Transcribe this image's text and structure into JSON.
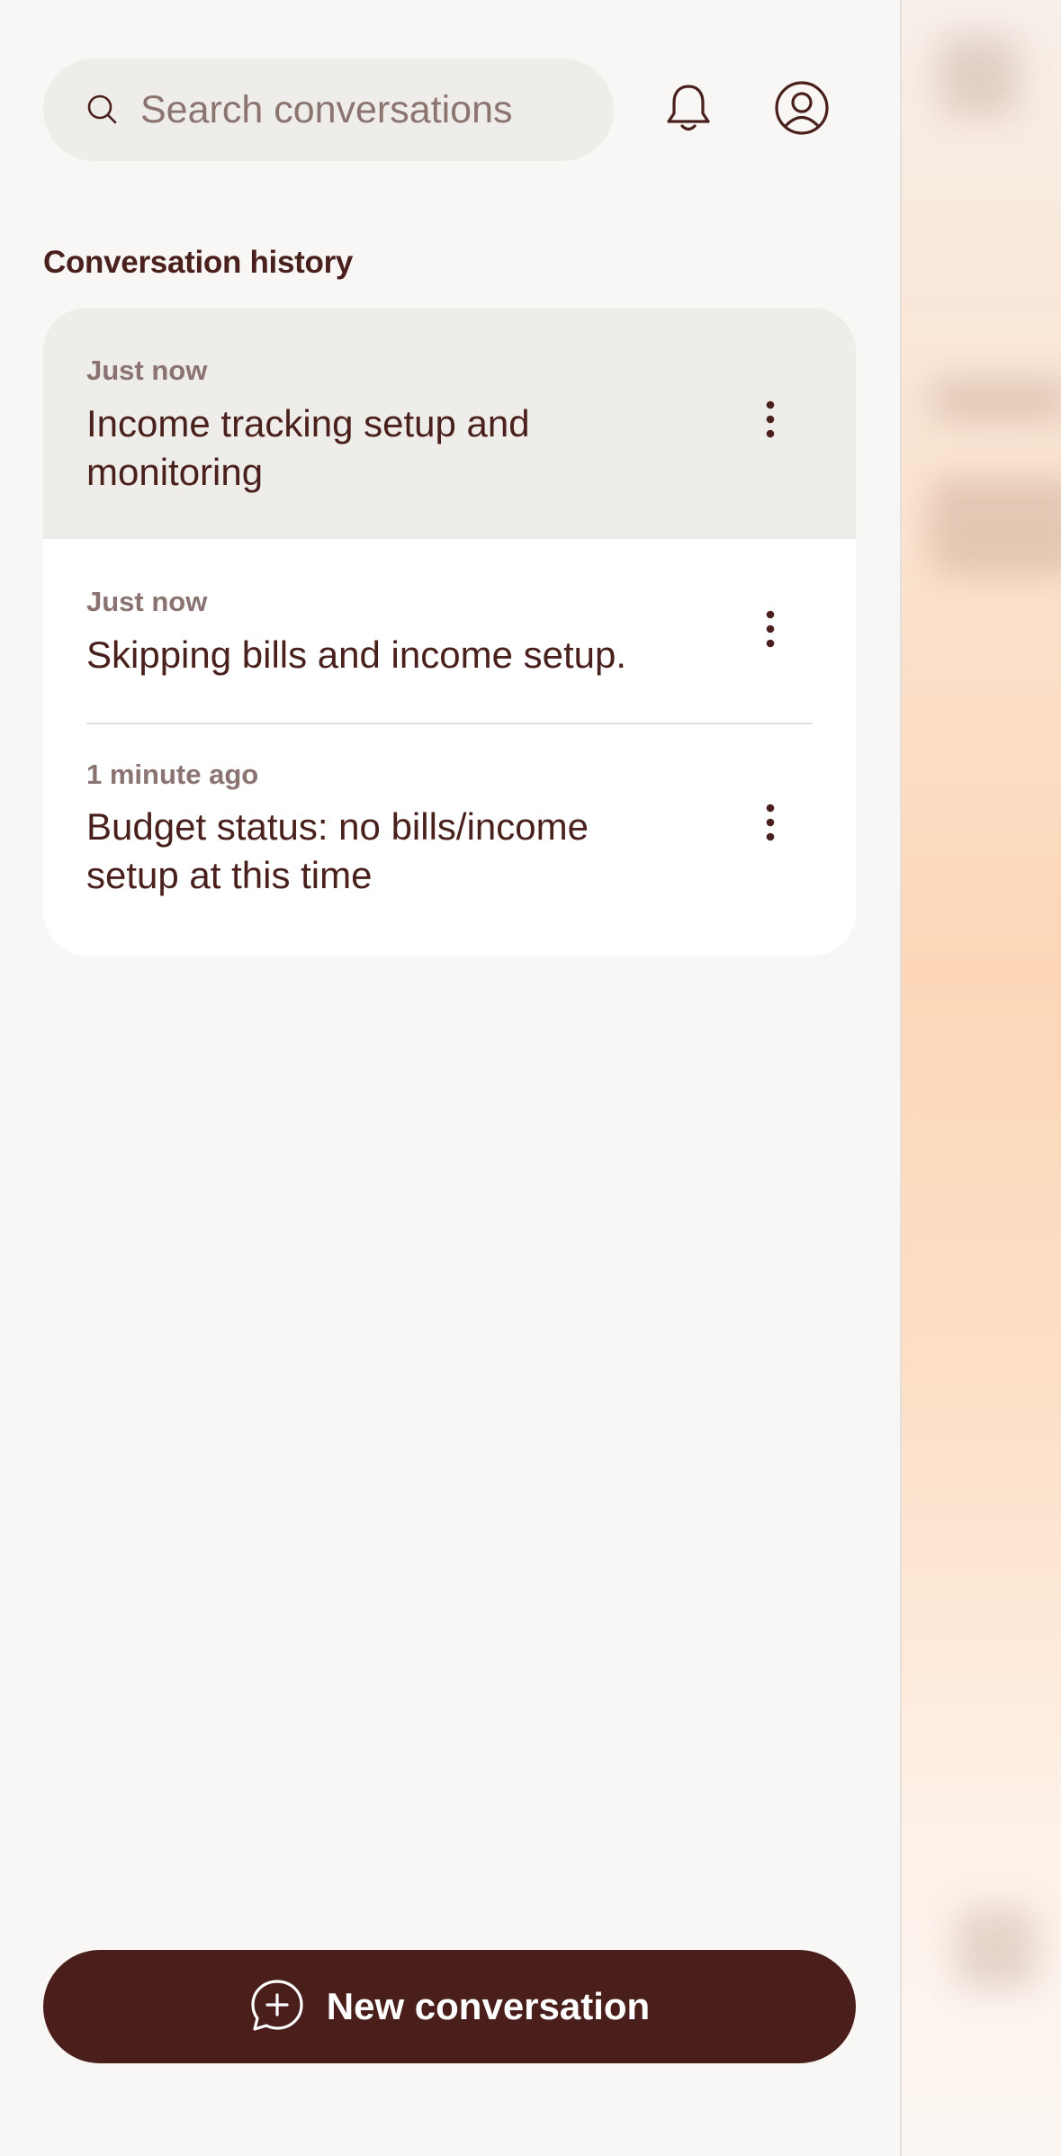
{
  "search": {
    "placeholder": "Search conversations",
    "value": ""
  },
  "header": {
    "notifications_icon": "bell-icon",
    "profile_icon": "user-circle-icon"
  },
  "history": {
    "title": "Conversation history",
    "items": [
      {
        "time": "Just now",
        "title": "Income tracking setup and monitoring",
        "active": true
      },
      {
        "time": "Just now",
        "title": "Skipping bills and income setup.",
        "active": false
      },
      {
        "time": "1 minute ago",
        "title": "Budget status: no bills/income setup at this time",
        "active": false
      }
    ]
  },
  "footer": {
    "new_conversation_label": "New conversation",
    "icon": "chat-plus-icon"
  },
  "colors": {
    "primary": "#4a1f1b",
    "text": "#4a201c",
    "muted_text": "#8a7370",
    "surface": "#f8f7f5",
    "card": "#ffffff",
    "active_row": "#efedea"
  }
}
